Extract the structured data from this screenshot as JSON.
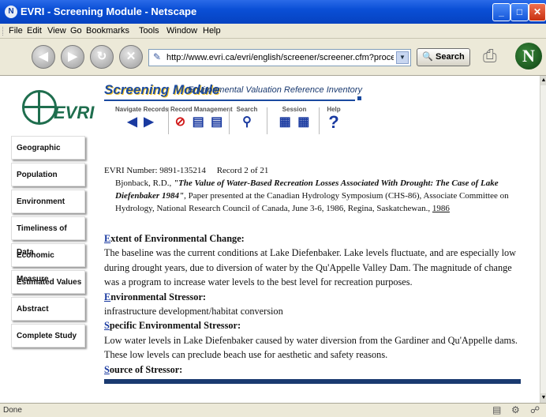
{
  "window": {
    "title": "EVRI - Screening Module - Netscape",
    "min_label": "_",
    "max_label": "□",
    "close_label": "✕"
  },
  "menu": [
    "File",
    "Edit",
    "View",
    "Go",
    "Bookmarks",
    "Tools",
    "Window",
    "Help"
  ],
  "toolbar": {
    "url": "http://www.evri.ca/evri/english/screener/screener.cfm?process=previ",
    "search_label": "Search",
    "back_icon": "back-arrow-icon",
    "forward_icon": "forward-arrow-icon",
    "reload_icon": "reload-icon",
    "stop_icon": "stop-icon"
  },
  "page": {
    "logo_text": "EVRI",
    "module_title": "Screening Module",
    "module_subtitle": "Environmental Valuation Reference Inventory",
    "nav_groups": {
      "navigate": "Navigate Records",
      "record": "Record Management",
      "search": "Search",
      "session": "Session",
      "help": "Help"
    },
    "side_nav": [
      "Geographic",
      "Population",
      "Environment",
      "Timeliness of Data",
      "Economic Measure",
      "Estimated Values",
      "Abstract",
      "Complete Study"
    ],
    "citation": {
      "record_number": "EVRI Number: 9891-135214",
      "record_position": "Record 2 of 21",
      "authors": "Bjonback, R.D.,",
      "title": "\"The Value of Water-Based Recreation Losses Associated With Drought: The Case of Lake Diefenbaker 1984\"",
      "details": ", Paper presented at the Canadian Hydrology Symposium (CHS-86), Associate Committee on Hydrology, National Research Council of Canada, June 3-6, 1986, Regina, Saskatchewan.,",
      "year": "1986"
    },
    "sections": [
      {
        "cap": "E",
        "rest": "xtent of Environmental Change:",
        "text": "The baseline was the current conditions at Lake Diefenbaker. Lake levels fluctuate, and are especially low during drought years, due to diversion of water by the Qu'Appelle Valley Dam. The magnitude of change was a program to increase water levels to the best level for recreation purposes."
      },
      {
        "cap": "E",
        "rest": "nvironmental Stressor:",
        "text": "infrastructure development/habitat conversion"
      },
      {
        "cap": "S",
        "rest": "pecific Environmental Stressor:",
        "text": "Low water levels in Lake Diefenbaker caused by water diversion from the Gardiner and Qu'Appelle dams. These low levels can preclude beach use for aesthetic and safety reasons."
      },
      {
        "cap": "S",
        "rest": "ource of Stressor:",
        "text": ""
      }
    ]
  },
  "status": {
    "text": "Done"
  }
}
